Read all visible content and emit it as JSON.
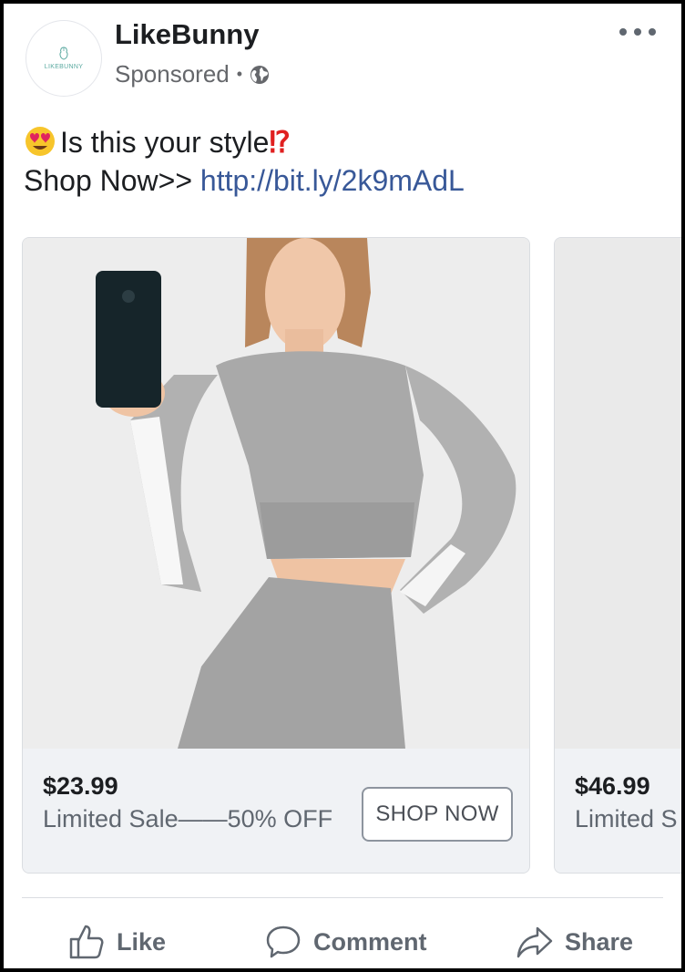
{
  "header": {
    "page_name": "LikeBunny",
    "avatar_text": "LIKEBUNNY",
    "sponsored": "Sponsored",
    "separator": "•",
    "audience_icon": "globe-icon",
    "menu_icon": "more-dots-icon"
  },
  "post": {
    "line1_text": "Is this your style",
    "line1_emoji": "heart-eyes-emoji",
    "line1_punct": "⁉",
    "line2_prefix": "Shop Now>> ",
    "link": "http://bit.ly/2k9mAdL"
  },
  "carousel": [
    {
      "image": "woman-grey-activewear-photo",
      "price": "$23.99",
      "description": "Limited Sale——50% OFF",
      "button": "SHOP NOW"
    },
    {
      "image": "product-photo",
      "price": "$46.99",
      "description": "Limited S"
    }
  ],
  "actions": {
    "like": "Like",
    "comment": "Comment",
    "share": "Share"
  },
  "colors": {
    "link": "#385898",
    "secondary_text": "#65676b",
    "card_footer": "#f0f2f5"
  }
}
